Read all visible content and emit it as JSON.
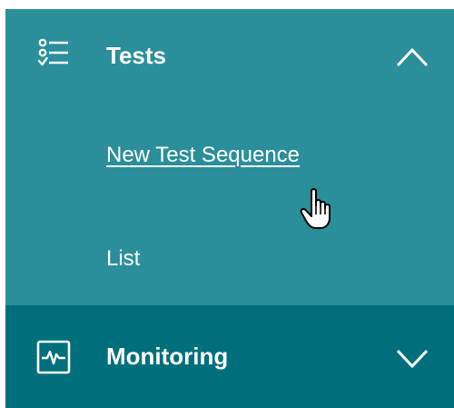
{
  "nav": {
    "tests": {
      "label": "Tests",
      "icon": "checklist-icon",
      "expanded": true,
      "items": [
        {
          "label": "New Test Sequence",
          "state": "hovered-link"
        },
        {
          "label": "List"
        }
      ]
    },
    "monitoring": {
      "label": "Monitoring",
      "icon": "monitor-pulse-icon",
      "expanded": false
    }
  },
  "colors": {
    "tests_bg": "#2a8f9a",
    "monitoring_bg": "#006f7c",
    "text": "#ffffff"
  },
  "pointer": "hand-pointer-icon"
}
